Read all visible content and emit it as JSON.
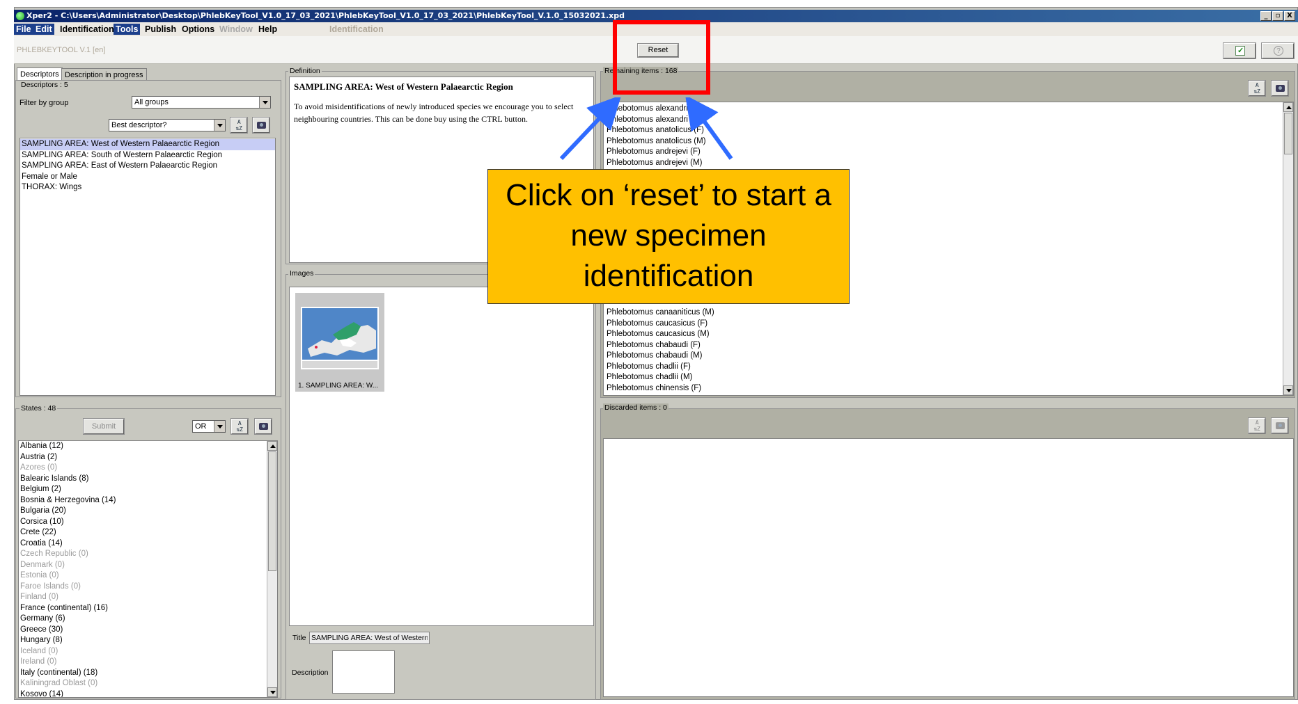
{
  "window": {
    "title": "Xper2 - C:\\Users\\Administrator\\Desktop\\PhlebKeyTool_V1.0_17_03_2021\\PhlebKeyTool_V1.0_17_03_2021\\PhlebKeyTool_V.1.0_15032021.xpd",
    "controls": [
      "_",
      "▫",
      "X"
    ]
  },
  "menubar": {
    "items": [
      "File",
      "Edit",
      "Identification",
      "Tools",
      "Publish",
      "Options",
      "Window",
      "Help"
    ],
    "context_label": "Identification"
  },
  "toolbar": {
    "key_name": "PHLEBKEYTOOL V.1 [en]",
    "reset_label": "Reset"
  },
  "descriptors": {
    "tabs": [
      "Descriptors",
      "Description in progress"
    ],
    "count_label": "Descriptors : 5",
    "filter_label": "Filter by group",
    "filter_value": "All groups",
    "sort_value": "Best descriptor?",
    "items": [
      {
        "text": "SAMPLING AREA: West of Western Palaearctic Region",
        "selected": true
      },
      {
        "text": "SAMPLING AREA: South of Western Palaearctic Region",
        "selected": false
      },
      {
        "text": "SAMPLING AREA: East of Western Palaearctic Region",
        "selected": false
      },
      {
        "text": "Female or Male",
        "selected": false
      },
      {
        "text": "THORAX: Wings",
        "selected": false
      }
    ]
  },
  "states": {
    "count_label": "States : 48",
    "submit_label": "Submit",
    "operator_value": "OR",
    "items": [
      {
        "text": "Albania (12)",
        "dim": false
      },
      {
        "text": "Austria (2)",
        "dim": false
      },
      {
        "text": "Azores (0)",
        "dim": true
      },
      {
        "text": "Balearic Islands (8)",
        "dim": false
      },
      {
        "text": "Belgium (2)",
        "dim": false
      },
      {
        "text": "Bosnia & Herzegovina (14)",
        "dim": false
      },
      {
        "text": "Bulgaria (20)",
        "dim": false
      },
      {
        "text": "Corsica (10)",
        "dim": false
      },
      {
        "text": "Crete (22)",
        "dim": false
      },
      {
        "text": "Croatia (14)",
        "dim": false
      },
      {
        "text": "Czech Republic (0)",
        "dim": true
      },
      {
        "text": "Denmark (0)",
        "dim": true
      },
      {
        "text": "Estonia (0)",
        "dim": true
      },
      {
        "text": "Faroe Islands (0)",
        "dim": true
      },
      {
        "text": "Finland (0)",
        "dim": true
      },
      {
        "text": "France (continental) (16)",
        "dim": false
      },
      {
        "text": "Germany (6)",
        "dim": false
      },
      {
        "text": "Greece (30)",
        "dim": false
      },
      {
        "text": "Hungary (8)",
        "dim": false
      },
      {
        "text": "Iceland (0)",
        "dim": true
      },
      {
        "text": "Ireland (0)",
        "dim": true
      },
      {
        "text": "Italy (continental) (18)",
        "dim": false
      },
      {
        "text": "Kaliningrad Oblast (0)",
        "dim": true
      },
      {
        "text": "Kosovo (14)",
        "dim": false
      }
    ]
  },
  "definition": {
    "label": "Definition",
    "heading": "SAMPLING AREA: West of Western Palaearctic Region",
    "body": "To avoid misidentifications of newly introduced species we encourage you to select neighbouring countries. This can be done buy using the CTRL button."
  },
  "images": {
    "label": "Images",
    "thumb_caption": "1. SAMPLING AREA: W...",
    "title_label": "Title",
    "title_value": "SAMPLING AREA: West of Western P",
    "description_label": "Description"
  },
  "remaining": {
    "count_label": "Remaining items : 168",
    "items_top": [
      "Phlebotomus alexandri (F)",
      "Phlebotomus alexandri (M)",
      "Phlebotomus anatolicus (F)",
      "Phlebotomus anatolicus (M)",
      "Phlebotomus andrejevi (F)",
      "Phlebotomus andrejevi (M)"
    ],
    "items_bottom": [
      "Phlebotomus canaaniticus (M)",
      "Phlebotomus caucasicus (F)",
      "Phlebotomus caucasicus (M)",
      "Phlebotomus chabaudi (F)",
      "Phlebotomus chabaudi (M)",
      "Phlebotomus chadlii (F)",
      "Phlebotomus chadlii (M)",
      "Phlebotomus chinensis (F)"
    ]
  },
  "discarded": {
    "count_label": "Discarded items : 0"
  },
  "annotation": {
    "callout_text": "Click on ‘reset’ to start a new specimen identification",
    "highlight_color": "#ff0000",
    "arrow_color": "#2f6bff",
    "callout_color": "#ffc000"
  },
  "icons": [
    "app-icon",
    "sort-az-icon",
    "camera-icon",
    "check-icon",
    "help-icon"
  ]
}
